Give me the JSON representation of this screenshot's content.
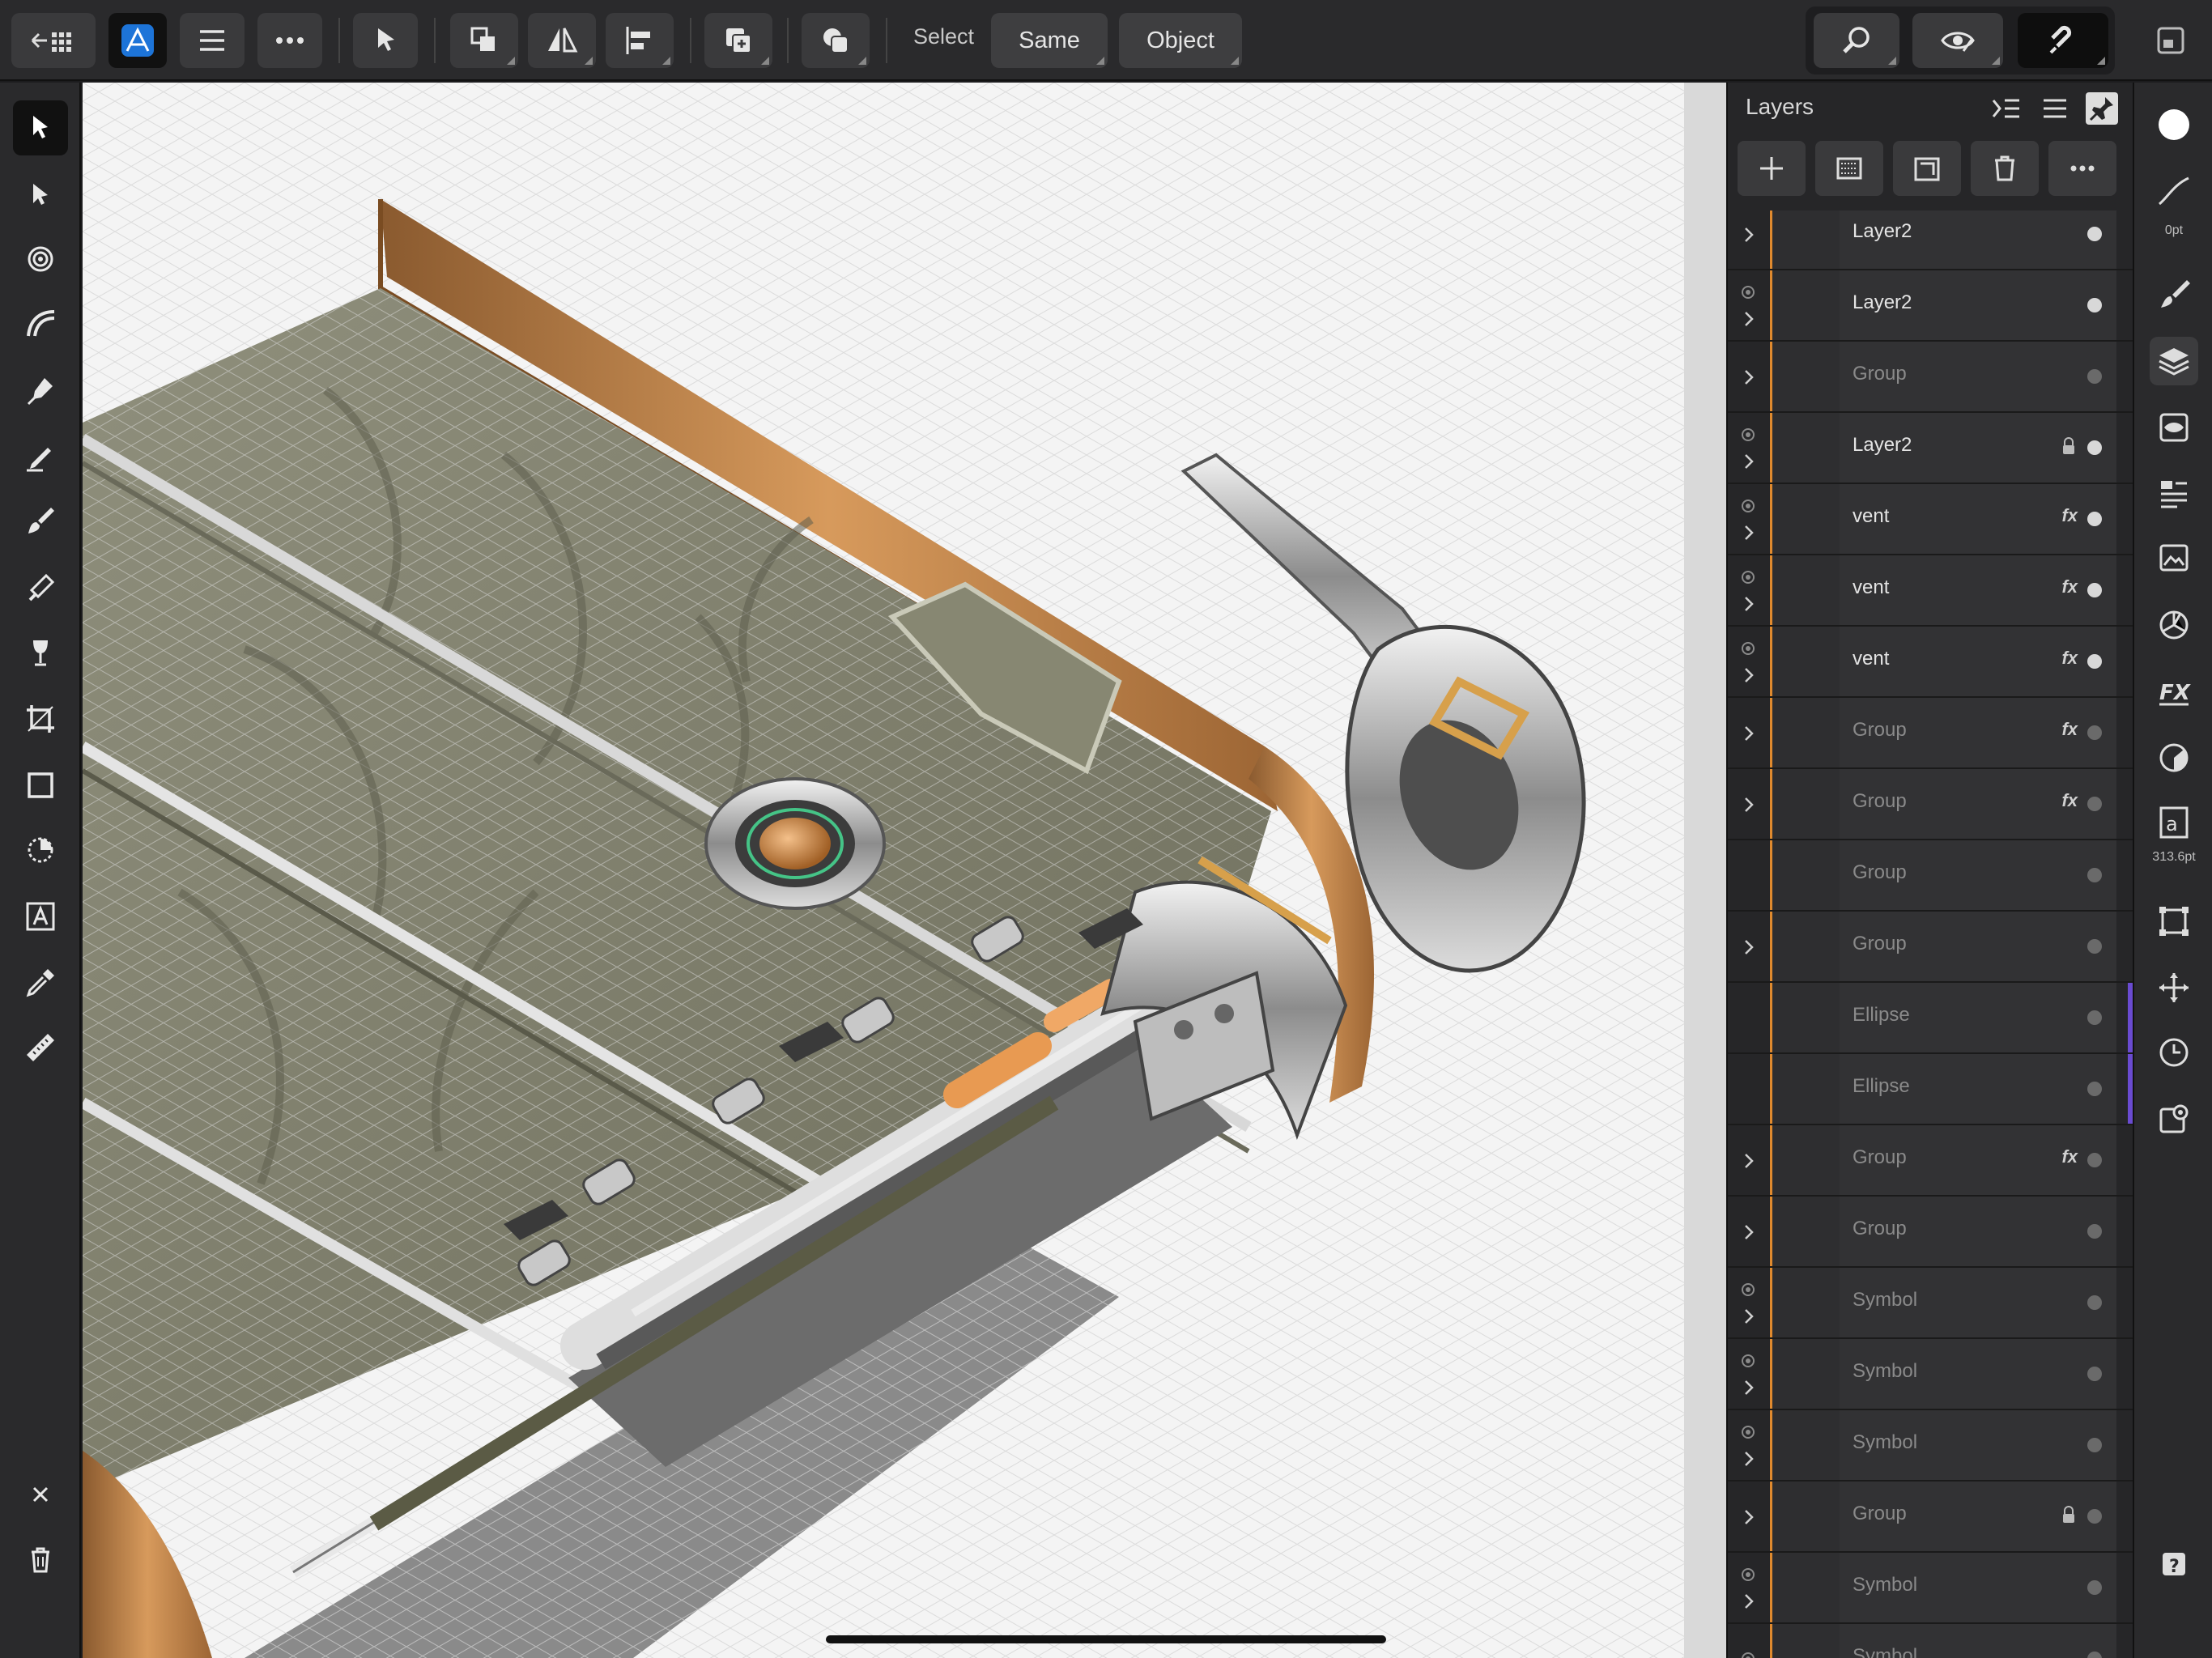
{
  "toolbar": {
    "select_label": "Select",
    "same_label": "Same",
    "object_label": "Object",
    "icons": [
      "grid-back-icon",
      "app-logo-icon",
      "menu-icon",
      "more-icon",
      "move-tool-icon",
      "arrange-icon",
      "flip-icon",
      "align-icon",
      "boolean-add-icon",
      "geometry-icon",
      "zoom-icon",
      "view-mode-icon",
      "snapping-icon",
      "window-icon"
    ]
  },
  "tools": [
    "move-tool",
    "node-tool",
    "corner-tool",
    "pencil-tool",
    "pen-tool",
    "vector-brush-tool",
    "paint-brush-tool",
    "fill-tool",
    "transparency-tool",
    "crop-tool",
    "rectangle-tool",
    "shape-tool",
    "artistic-text-tool",
    "color-picker-tool",
    "measure-tool"
  ],
  "layers_panel": {
    "title": "Layers",
    "rows": [
      {
        "name": "Layer2",
        "dim": false,
        "fx": false,
        "lock": false,
        "vis": false,
        "chevron": true
      },
      {
        "name": "Layer2",
        "dim": false,
        "fx": false,
        "lock": false,
        "vis": true,
        "chevron": true
      },
      {
        "name": "Group",
        "dim": true,
        "fx": false,
        "lock": false,
        "vis": false,
        "chevron": true
      },
      {
        "name": "Layer2",
        "dim": false,
        "fx": false,
        "lock": true,
        "vis": true,
        "chevron": true
      },
      {
        "name": "vent",
        "dim": false,
        "fx": true,
        "lock": false,
        "vis": true,
        "chevron": true
      },
      {
        "name": "vent",
        "dim": false,
        "fx": true,
        "lock": false,
        "vis": true,
        "chevron": true
      },
      {
        "name": "vent",
        "dim": false,
        "fx": true,
        "lock": false,
        "vis": true,
        "chevron": true
      },
      {
        "name": "Group",
        "dim": true,
        "fx": true,
        "lock": false,
        "vis": false,
        "chevron": true
      },
      {
        "name": "Group",
        "dim": true,
        "fx": true,
        "lock": false,
        "vis": false,
        "chevron": true
      },
      {
        "name": "Group",
        "dim": true,
        "fx": false,
        "lock": false,
        "vis": false,
        "chevron": false
      },
      {
        "name": "Group",
        "dim": true,
        "fx": false,
        "lock": false,
        "vis": false,
        "chevron": true
      },
      {
        "name": "Ellipse",
        "dim": true,
        "fx": false,
        "lock": false,
        "vis": false,
        "chevron": false
      },
      {
        "name": "Ellipse",
        "dim": true,
        "fx": false,
        "lock": false,
        "vis": false,
        "chevron": false
      },
      {
        "name": "Group",
        "dim": true,
        "fx": true,
        "lock": false,
        "vis": false,
        "chevron": true
      },
      {
        "name": "Group",
        "dim": true,
        "fx": false,
        "lock": false,
        "vis": false,
        "chevron": true
      },
      {
        "name": "Symbol",
        "dim": true,
        "fx": false,
        "lock": false,
        "vis": true,
        "chevron": true
      },
      {
        "name": "Symbol",
        "dim": true,
        "fx": false,
        "lock": false,
        "vis": true,
        "chevron": true
      },
      {
        "name": "Symbol",
        "dim": true,
        "fx": false,
        "lock": false,
        "vis": true,
        "chevron": true
      },
      {
        "name": "Group",
        "dim": true,
        "fx": false,
        "lock": true,
        "vis": false,
        "chevron": true
      },
      {
        "name": "Symbol",
        "dim": true,
        "fx": false,
        "lock": false,
        "vis": true,
        "chevron": true
      },
      {
        "name": "Symbol",
        "dim": true,
        "fx": false,
        "lock": false,
        "vis": true,
        "chevron": false
      }
    ]
  },
  "studio": {
    "stroke_width": "0pt",
    "font_size": "313.6pt"
  },
  "colors": {
    "accent_orange": "#e08a2e",
    "selection_purple": "#6a4bd1",
    "panel_bg": "#262628",
    "canvas_bg": "#f3f3f3"
  }
}
